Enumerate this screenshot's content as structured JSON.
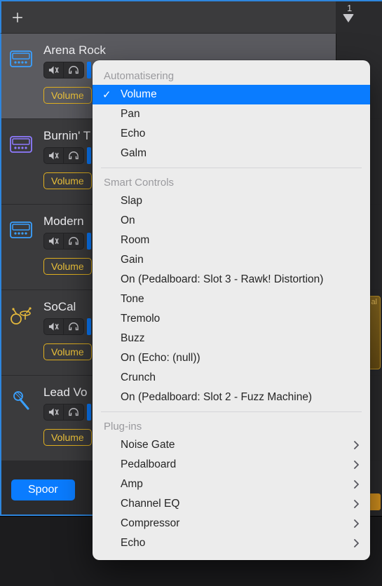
{
  "ruler": {
    "marker": "1"
  },
  "tracks": [
    {
      "name": "Arena Rock",
      "volume_label": "Volume",
      "icon_color": "#3aa0ff",
      "selected": true,
      "region": null
    },
    {
      "name": "Burnin' T",
      "volume_label": "Volume",
      "icon_color": "#8e7bff",
      "selected": false,
      "region": null
    },
    {
      "name": "Modern",
      "volume_label": "Volume",
      "icon_color": "#3aa0ff",
      "selected": false,
      "region": null
    },
    {
      "name": "SoCal",
      "volume_label": "Volume",
      "icon_color": "#e5b93c",
      "selected": false,
      "region": "al"
    },
    {
      "name": "Lead Vo",
      "volume_label": "Volume",
      "icon_color": "#3aa0ff",
      "selected": false,
      "region": null
    }
  ],
  "master_button": "Spoor",
  "popup": {
    "sections": [
      {
        "label": "Automatisering",
        "items": [
          {
            "label": "Volume",
            "selected": true,
            "submenu": false
          },
          {
            "label": "Pan",
            "selected": false,
            "submenu": false
          },
          {
            "label": "Echo",
            "selected": false,
            "submenu": false
          },
          {
            "label": "Galm",
            "selected": false,
            "submenu": false
          }
        ]
      },
      {
        "label": "Smart Controls",
        "items": [
          {
            "label": "Slap",
            "selected": false,
            "submenu": false
          },
          {
            "label": "On",
            "selected": false,
            "submenu": false
          },
          {
            "label": "Room",
            "selected": false,
            "submenu": false
          },
          {
            "label": "Gain",
            "selected": false,
            "submenu": false
          },
          {
            "label": "On (Pedalboard: Slot 3 - Rawk! Distortion)",
            "selected": false,
            "submenu": false
          },
          {
            "label": "Tone",
            "selected": false,
            "submenu": false
          },
          {
            "label": "Tremolo",
            "selected": false,
            "submenu": false
          },
          {
            "label": "Buzz",
            "selected": false,
            "submenu": false
          },
          {
            "label": "On (Echo: (null))",
            "selected": false,
            "submenu": false
          },
          {
            "label": "Crunch",
            "selected": false,
            "submenu": false
          },
          {
            "label": "On (Pedalboard: Slot 2 - Fuzz Machine)",
            "selected": false,
            "submenu": false
          }
        ]
      },
      {
        "label": "Plug-ins",
        "items": [
          {
            "label": "Noise Gate",
            "selected": false,
            "submenu": true
          },
          {
            "label": "Pedalboard",
            "selected": false,
            "submenu": true
          },
          {
            "label": "Amp",
            "selected": false,
            "submenu": true
          },
          {
            "label": "Channel EQ",
            "selected": false,
            "submenu": true
          },
          {
            "label": "Compressor",
            "selected": false,
            "submenu": true
          },
          {
            "label": "Echo",
            "selected": false,
            "submenu": true
          }
        ]
      }
    ]
  }
}
